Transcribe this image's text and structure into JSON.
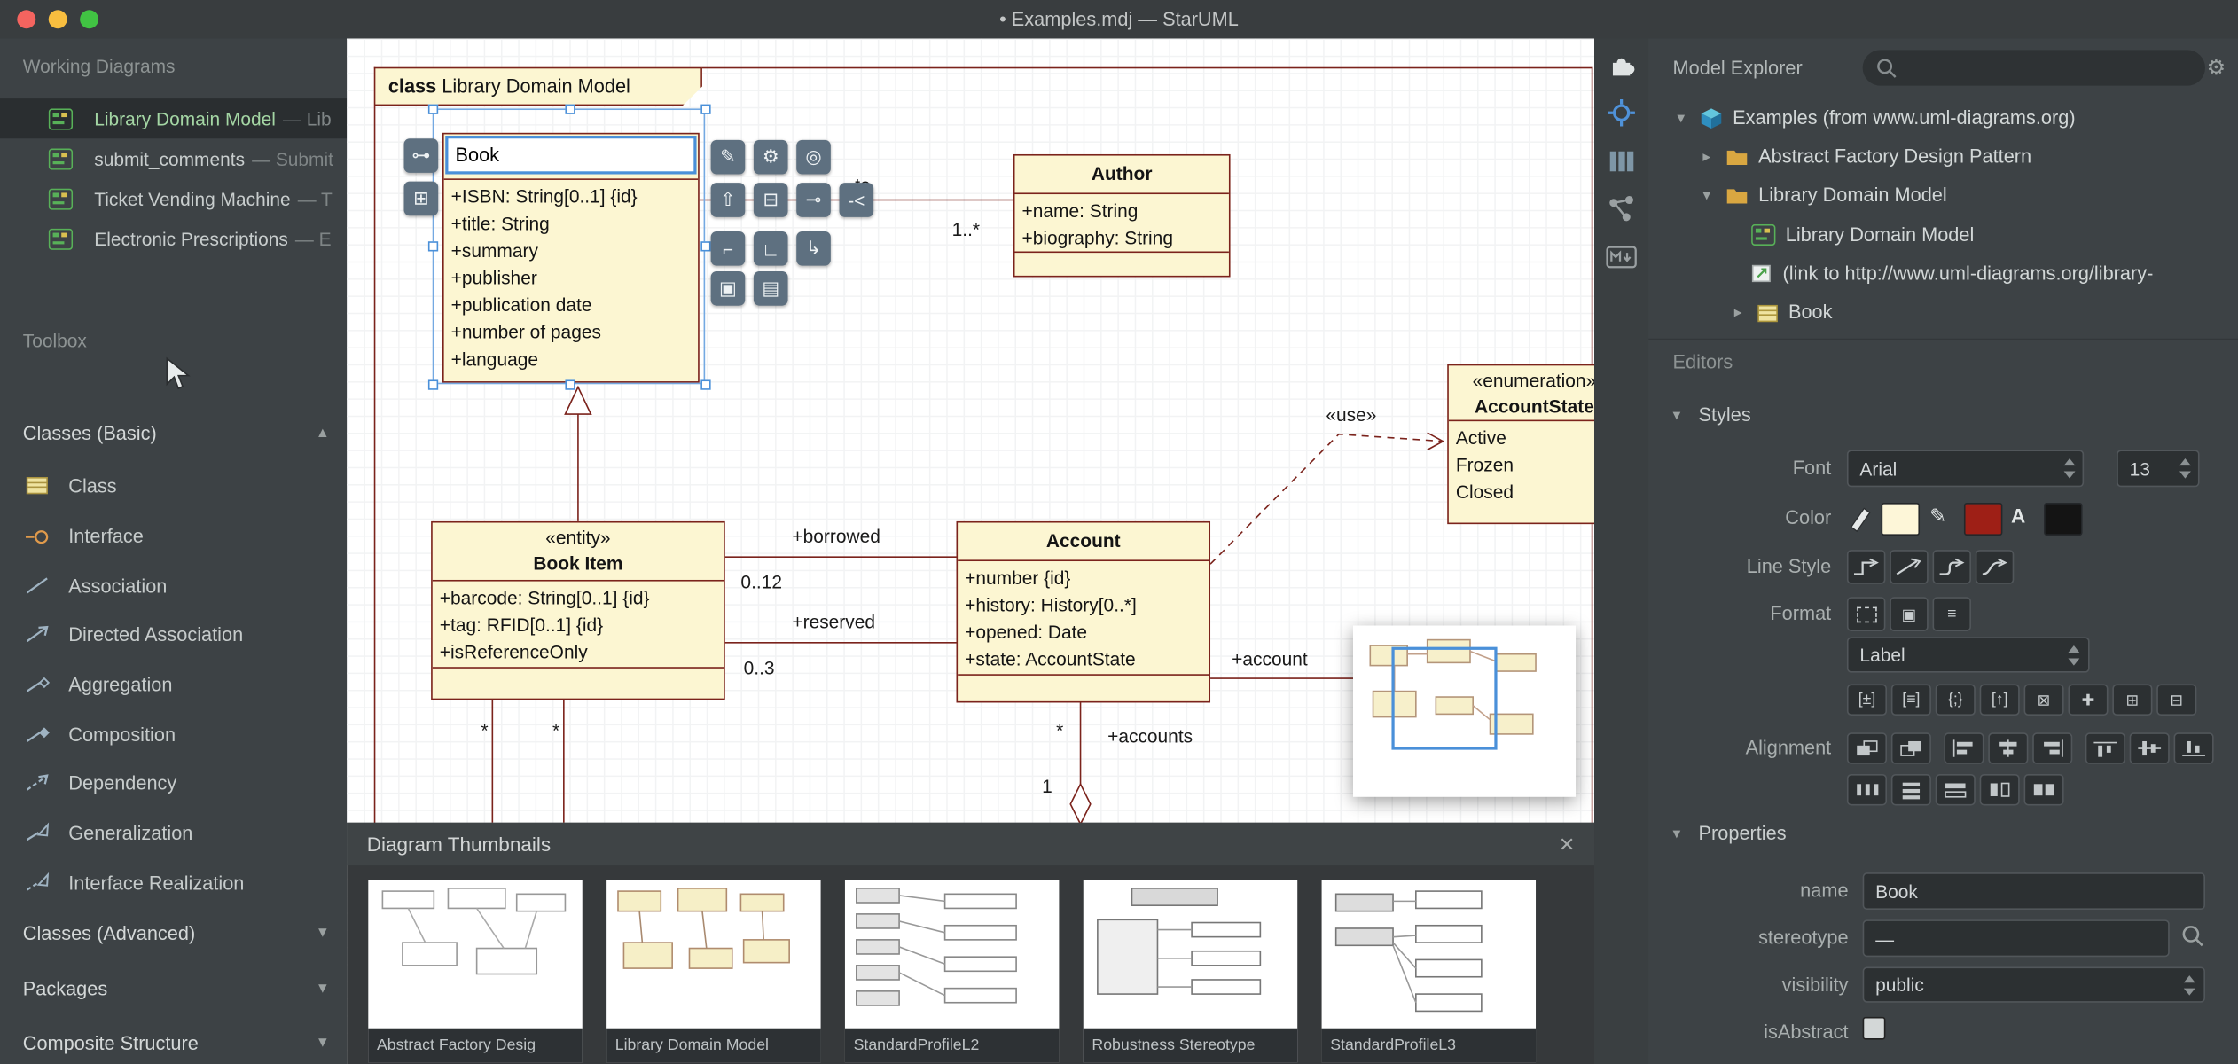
{
  "icons": {
    "close": "×",
    "gear": "⚙",
    "pencil": "✎",
    "font_a": "A",
    "expand_down": "▾",
    "expand_right": "▸",
    "collapse_up": "▲",
    "collapse_down": "▼",
    "square": "▣",
    "hamburger": "≡",
    "bracket_pm": "[±]",
    "bracket_eq": "[≡]",
    "brace_semi": "{;}",
    "bracket_up": "[↑]",
    "boxx": "⊠",
    "plus": "✚",
    "boxplus": "⊞",
    "boxminus": "⊟"
  },
  "colors": {
    "accent": "#4a90d9",
    "class_fill": "#fcf6d2",
    "class_stroke": "#7b231c",
    "fill_swatch": "#fdf6d8",
    "line_swatch": "#9e1f16",
    "font_swatch": "#141414"
  },
  "titlebar": {
    "title": "• Examples.mdj — StarUML"
  },
  "left": {
    "working_label": "Working Diagrams",
    "diagrams": [
      {
        "name": "Library Domain Model",
        "suffix": "— Lib"
      },
      {
        "name": "submit_comments",
        "suffix": "— Submit"
      },
      {
        "name": "Ticket Vending Machine",
        "suffix": "— T"
      },
      {
        "name": "Electronic Prescriptions",
        "suffix": "— E"
      }
    ],
    "toolbox_label": "Toolbox",
    "basic_label": "Classes (Basic)",
    "advanced_label": "Classes (Advanced)",
    "packages_label": "Packages",
    "composite_label": "Composite Structure",
    "tools": [
      "Class",
      "Interface",
      "Association",
      "Directed Association",
      "Aggregation",
      "Composition",
      "Dependency",
      "Generalization",
      "Interface Realization"
    ]
  },
  "diagram": {
    "frame_keyword": "class",
    "frame_title": "Library Domain Model",
    "book": {
      "name": "Book",
      "attrs": [
        "+ISBN: String[0..1] {id}",
        "+title: String",
        "+summary",
        "+publisher",
        "+publication date",
        "+number of pages",
        "+language"
      ]
    },
    "author": {
      "name": "Author",
      "attrs": [
        "+name: String",
        "+biography: String"
      ]
    },
    "book_item": {
      "stereotype": "«entity»",
      "name": "Book Item",
      "attrs": [
        "+barcode: String[0..1] {id}",
        "+tag: RFID[0..1] {id}",
        "+isReferenceOnly"
      ]
    },
    "account": {
      "name": "Account",
      "attrs": [
        "+number {id}",
        "+history: History[0..*]",
        "+opened: Date",
        "+state: AccountState"
      ]
    },
    "enumeration": {
      "stereotype": "«enumeration»",
      "name": "AccountState",
      "literals": [
        "Active",
        "Frozen",
        "Closed"
      ]
    },
    "labels": {
      "partial": "te",
      "author_mult": "1..*",
      "borrowed": "+borrowed",
      "borrowed_mult": "0..12",
      "reserved": "+reserved",
      "reserved_mult": "0..3",
      "use": "«use»",
      "account": "+account",
      "accounts": "+accounts",
      "account_star": "*",
      "account_one": "1",
      "item_star_a": "*",
      "item_star_b": "*"
    },
    "quick_glyphs": [
      "⊶",
      "⊞",
      "✎",
      "⚙",
      "◎",
      "⇧",
      "⊟",
      "⊸",
      "-<",
      "⌐",
      "∟",
      "↳",
      "▣",
      "▤"
    ]
  },
  "thumbs": {
    "title": "Diagram Thumbnails",
    "items": [
      "Abstract Factory Desig",
      "Library Domain Model",
      "StandardProfileL2",
      "Robustness Stereotype",
      "StandardProfileL3"
    ]
  },
  "explorer": {
    "title": "Model Explorer",
    "tree": [
      "Examples (from www.uml-diagrams.org)",
      "Abstract Factory Design Pattern",
      "Library Domain Model",
      "Library Domain Model",
      "(link to http://www.uml-diagrams.org/library-",
      "Book"
    ]
  },
  "editors_label": "Editors",
  "styles": {
    "title": "Styles",
    "font_label": "Font",
    "font_value": "Arial",
    "font_size": "13",
    "color_label": "Color",
    "line_style_label": "Line Style",
    "format_label": "Format",
    "dropdown_value": "Label",
    "alignment_label": "Alignment"
  },
  "properties": {
    "title": "Properties",
    "name_label": "name",
    "name_value": "Book",
    "stereotype_label": "stereotype",
    "stereotype_value": "—",
    "visibility_label": "visibility",
    "visibility_value": "public",
    "isabstract_label": "isAbstract"
  }
}
